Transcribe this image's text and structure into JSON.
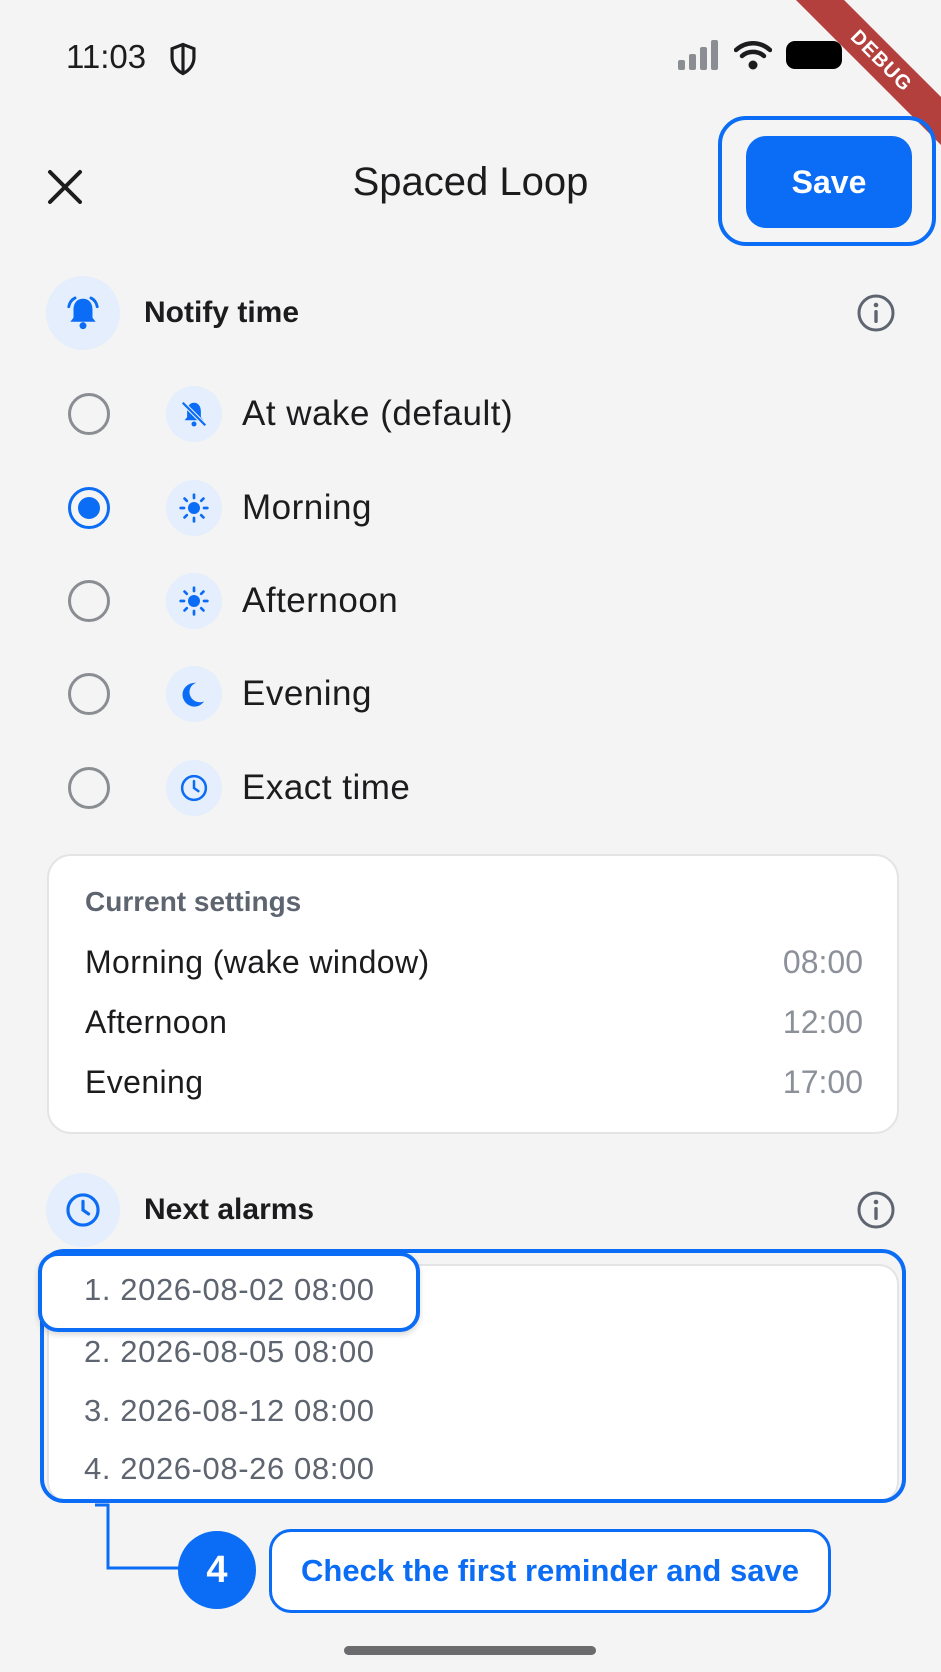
{
  "status_bar": {
    "time": "11:03",
    "debug_label": "DEBUG"
  },
  "header": {
    "title": "Spaced Loop",
    "save_label": "Save"
  },
  "notify_section": {
    "title": "Notify time"
  },
  "options": [
    {
      "label": "At wake (default)",
      "icon": "bell-off-icon",
      "selected": false
    },
    {
      "label": "Morning",
      "icon": "sun-icon",
      "selected": true
    },
    {
      "label": "Afternoon",
      "icon": "sun-icon",
      "selected": false
    },
    {
      "label": "Evening",
      "icon": "moon-icon",
      "selected": false
    },
    {
      "label": "Exact time",
      "icon": "clock-icon",
      "selected": false
    }
  ],
  "current_settings": {
    "title": "Current settings",
    "rows": [
      {
        "label": "Morning (wake window)",
        "value": "08:00"
      },
      {
        "label": "Afternoon",
        "value": "12:00"
      },
      {
        "label": "Evening",
        "value": "17:00"
      }
    ]
  },
  "alarms_section": {
    "title": "Next alarms"
  },
  "alarms": [
    "1. 2026-08-02 08:00",
    "2. 2026-08-05 08:00",
    "3. 2026-08-12 08:00",
    "4. 2026-08-26 08:00"
  ],
  "tutorial": {
    "step": "4",
    "text": "Check the first reminder and save"
  },
  "colors": {
    "accent": "#0b6cf5",
    "background": "#f4f4f4",
    "debug": "#b3403d"
  }
}
